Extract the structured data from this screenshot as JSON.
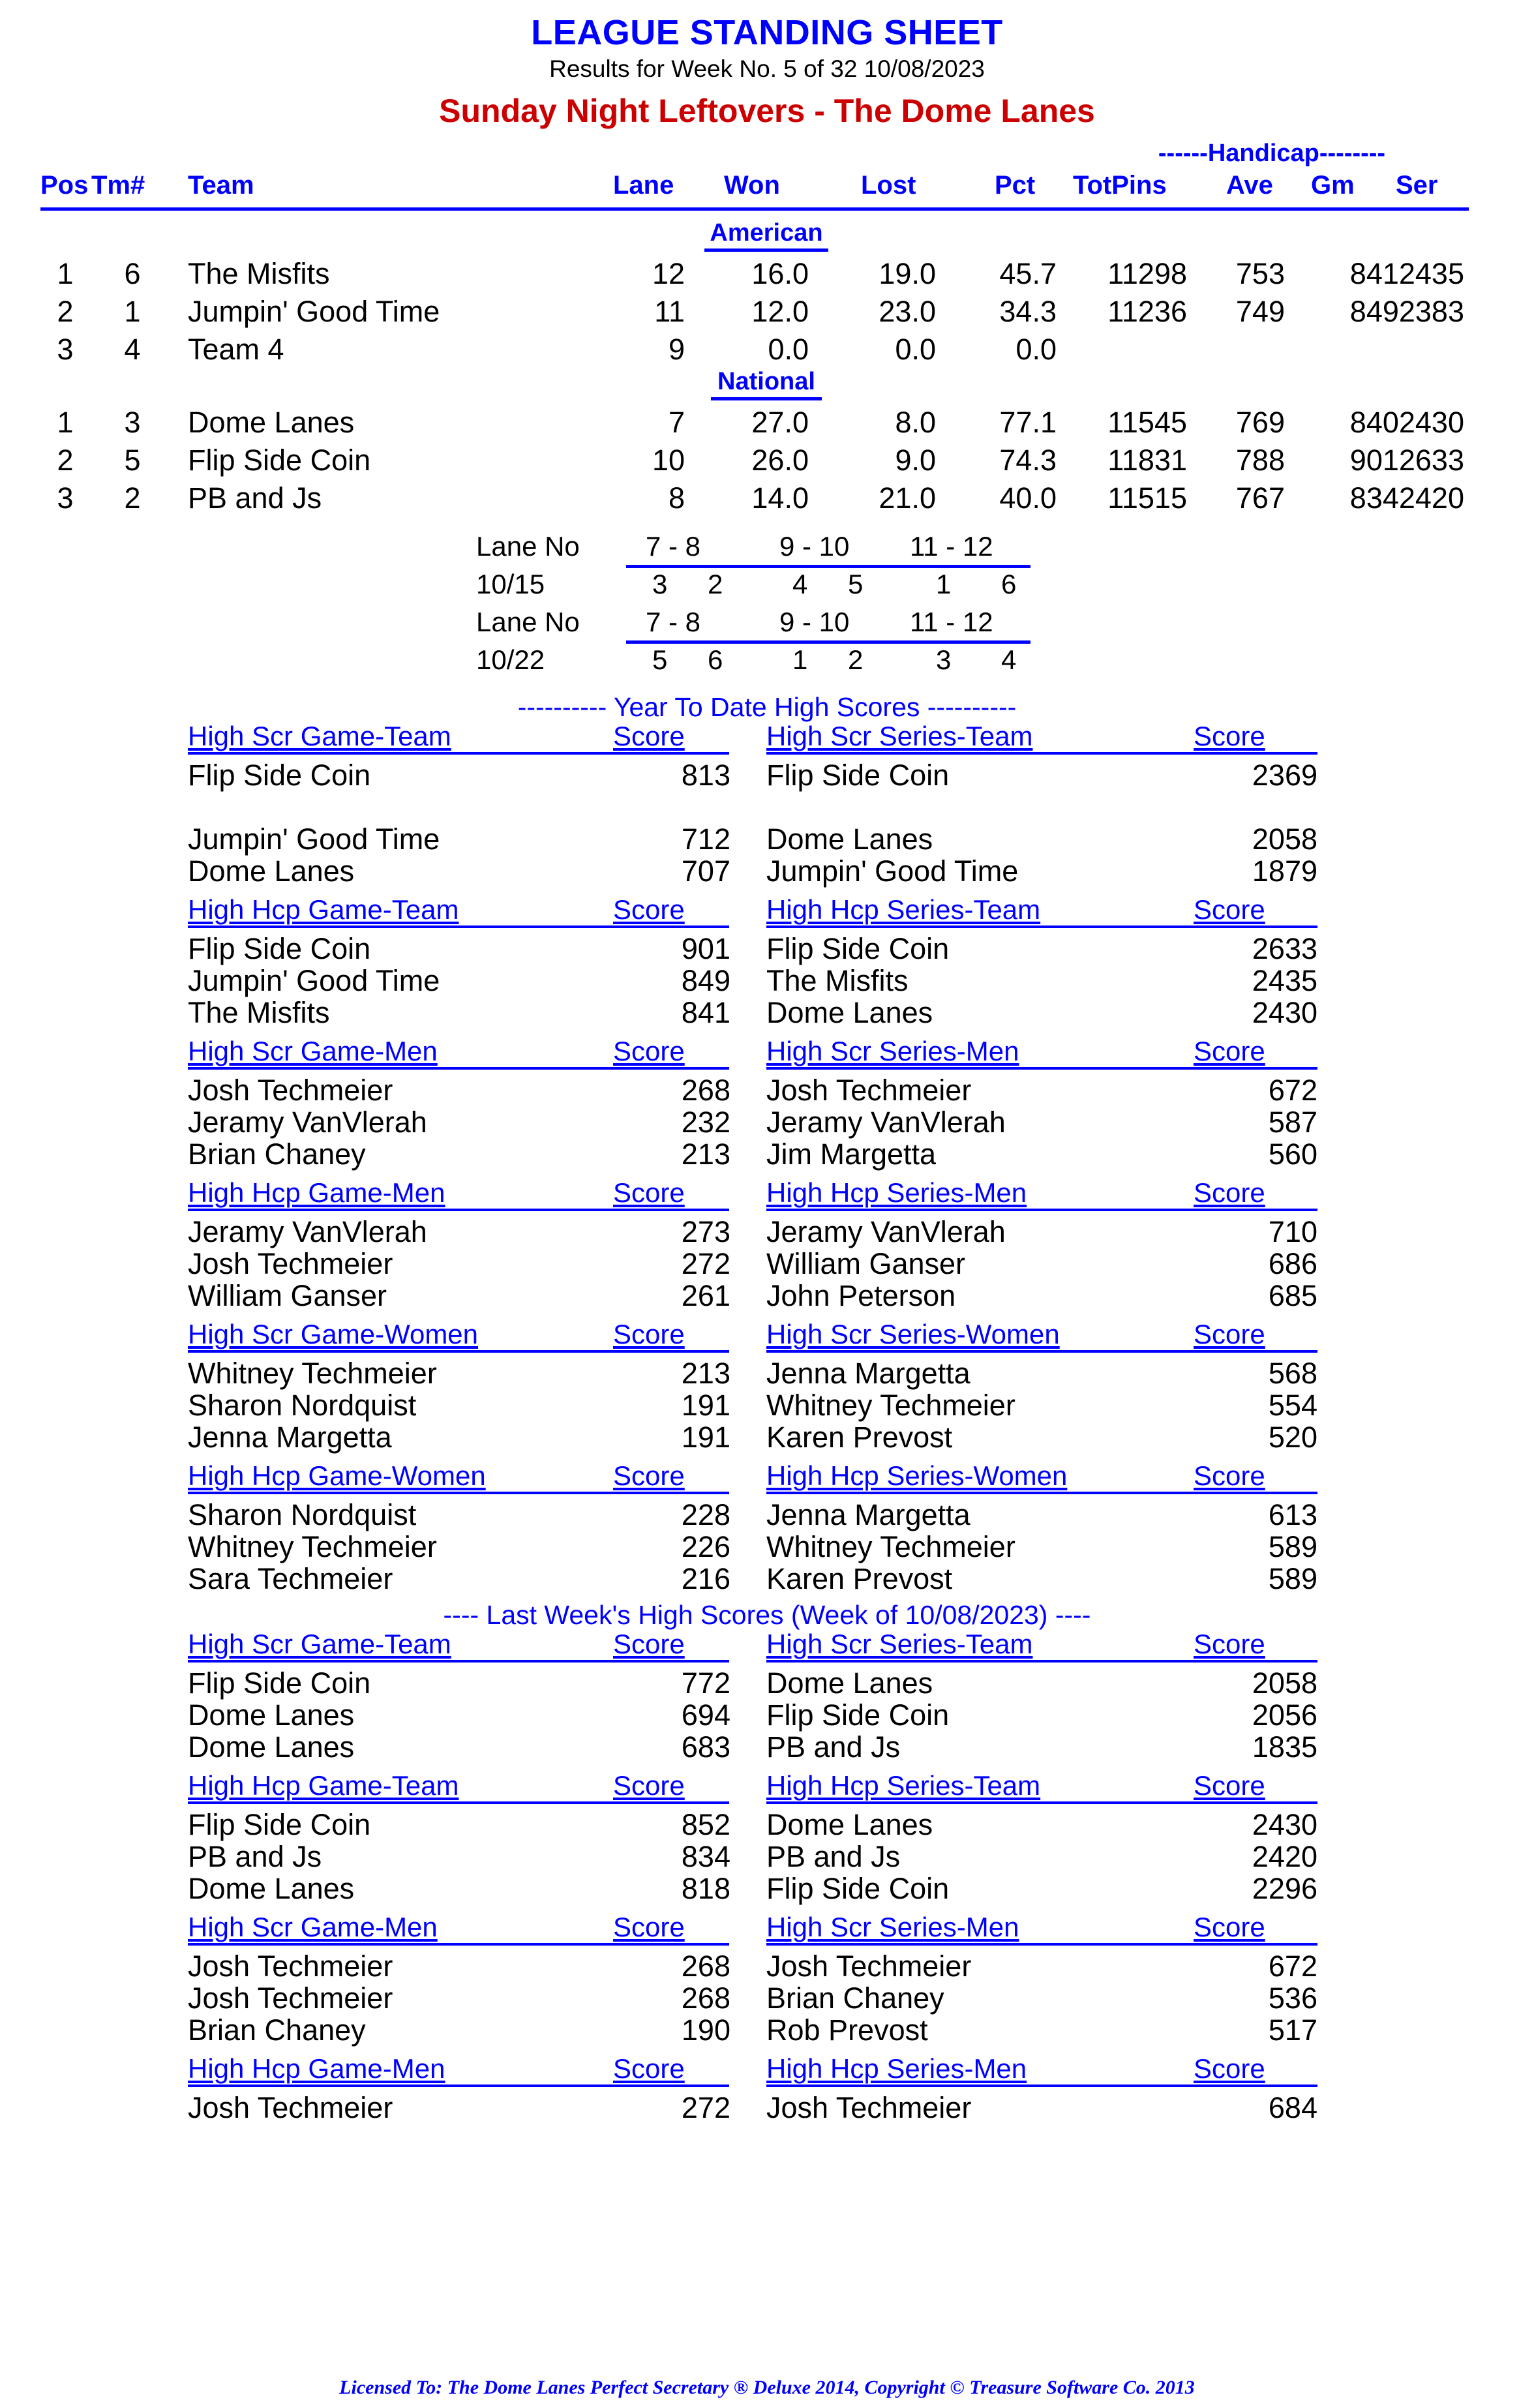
{
  "header": {
    "title": "LEAGUE STANDING SHEET",
    "subtitle": "Results for Week No. 5 of 32    10/08/2023",
    "league_title": "Sunday Night Leftovers - The Dome Lanes",
    "title_color": "#0000ff",
    "league_color": "#cc0000"
  },
  "standings": {
    "handicap_span_label": "------Handicap--------",
    "columns": {
      "pos": "Pos",
      "tm": "Tm#",
      "team": "Team",
      "lane": "Lane",
      "won": "Won",
      "lost": "Lost",
      "pct": "Pct",
      "totpins": "TotPins",
      "ave": "Ave",
      "gm": "Gm",
      "ser": "Ser"
    },
    "divisions": [
      {
        "name": "American",
        "rows": [
          {
            "pos": "1",
            "tm": "6",
            "team": "The Misfits",
            "lane": "12",
            "won": "16.0",
            "lost": "19.0",
            "pct": "45.7",
            "totpins": "11298",
            "ave": "753",
            "gm": "841",
            "ser": "2435"
          },
          {
            "pos": "2",
            "tm": "1",
            "team": "Jumpin' Good Time",
            "lane": "11",
            "won": "12.0",
            "lost": "23.0",
            "pct": "34.3",
            "totpins": "11236",
            "ave": "749",
            "gm": "849",
            "ser": "2383"
          },
          {
            "pos": "3",
            "tm": "4",
            "team": "Team 4",
            "lane": "9",
            "won": "0.0",
            "lost": "0.0",
            "pct": "0.0",
            "totpins": "",
            "ave": "",
            "gm": "",
            "ser": ""
          }
        ]
      },
      {
        "name": "National",
        "rows": [
          {
            "pos": "1",
            "tm": "3",
            "team": "Dome Lanes",
            "lane": "7",
            "won": "27.0",
            "lost": "8.0",
            "pct": "77.1",
            "totpins": "11545",
            "ave": "769",
            "gm": "840",
            "ser": "2430"
          },
          {
            "pos": "2",
            "tm": "5",
            "team": "Flip Side Coin",
            "lane": "10",
            "won": "26.0",
            "lost": "9.0",
            "pct": "74.3",
            "totpins": "11831",
            "ave": "788",
            "gm": "901",
            "ser": "2633"
          },
          {
            "pos": "3",
            "tm": "2",
            "team": "PB and Js",
            "lane": "8",
            "won": "14.0",
            "lost": "21.0",
            "pct": "40.0",
            "totpins": "11515",
            "ave": "767",
            "gm": "834",
            "ser": "2420"
          }
        ]
      }
    ]
  },
  "lane_schedule": [
    {
      "label": "Lane No",
      "pairs": [
        "7 -  8",
        "9 - 10",
        "11 - 12"
      ],
      "date": "10/15",
      "teams": [
        "3",
        "2",
        "4",
        "5",
        "1",
        "6"
      ]
    },
    {
      "label": "Lane No",
      "pairs": [
        "7 -  8",
        "9 - 10",
        "11 - 12"
      ],
      "date": "10/22",
      "teams": [
        "5",
        "6",
        "1",
        "2",
        "3",
        "4"
      ]
    }
  ],
  "ytd": {
    "separator": "---------- Year To Date High Scores ----------",
    "blocks": [
      {
        "left_header": "High Scr Game-Team",
        "left_score_header": "Score",
        "right_header": "High Scr Series-Team",
        "right_score_header": "Score",
        "left_rows": [
          {
            "name": "Flip Side Coin",
            "score": "813"
          },
          {
            "name": "",
            "score": ""
          },
          {
            "name": "Jumpin' Good Time",
            "score": "712"
          },
          {
            "name": "Dome Lanes",
            "score": "707"
          }
        ],
        "right_rows": [
          {
            "name": "Flip Side Coin",
            "score": "2369"
          },
          {
            "name": "",
            "score": ""
          },
          {
            "name": "Dome Lanes",
            "score": "2058"
          },
          {
            "name": "Jumpin' Good Time",
            "score": "1879"
          }
        ]
      },
      {
        "left_header": "High Hcp Game-Team",
        "left_score_header": "Score",
        "right_header": "High Hcp Series-Team",
        "right_score_header": "Score",
        "left_rows": [
          {
            "name": "Flip Side Coin",
            "score": "901"
          },
          {
            "name": "Jumpin' Good Time",
            "score": "849"
          },
          {
            "name": "The Misfits",
            "score": "841"
          }
        ],
        "right_rows": [
          {
            "name": "Flip Side Coin",
            "score": "2633"
          },
          {
            "name": "The Misfits",
            "score": "2435"
          },
          {
            "name": "Dome Lanes",
            "score": "2430"
          }
        ]
      },
      {
        "left_header": "High Scr Game-Men",
        "left_score_header": "Score",
        "right_header": "High Scr Series-Men",
        "right_score_header": "Score",
        "left_rows": [
          {
            "name": "Josh Techmeier",
            "score": "268"
          },
          {
            "name": "Jeramy VanVlerah",
            "score": "232"
          },
          {
            "name": "Brian Chaney",
            "score": "213"
          }
        ],
        "right_rows": [
          {
            "name": "Josh Techmeier",
            "score": "672"
          },
          {
            "name": "Jeramy VanVlerah",
            "score": "587"
          },
          {
            "name": "Jim Margetta",
            "score": "560"
          }
        ]
      },
      {
        "left_header": "High Hcp Game-Men",
        "left_score_header": "Score",
        "right_header": "High Hcp Series-Men",
        "right_score_header": "Score",
        "left_rows": [
          {
            "name": "Jeramy VanVlerah",
            "score": "273"
          },
          {
            "name": "Josh Techmeier",
            "score": "272"
          },
          {
            "name": "William Ganser",
            "score": "261"
          }
        ],
        "right_rows": [
          {
            "name": "Jeramy VanVlerah",
            "score": "710"
          },
          {
            "name": "William Ganser",
            "score": "686"
          },
          {
            "name": "John Peterson",
            "score": "685"
          }
        ]
      },
      {
        "left_header": "High Scr Game-Women",
        "left_score_header": "Score",
        "right_header": "High Scr Series-Women",
        "right_score_header": "Score",
        "left_rows": [
          {
            "name": "Whitney Techmeier",
            "score": "213"
          },
          {
            "name": "Sharon Nordquist",
            "score": "191"
          },
          {
            "name": "Jenna Margetta",
            "score": "191"
          }
        ],
        "right_rows": [
          {
            "name": "Jenna Margetta",
            "score": "568"
          },
          {
            "name": "Whitney Techmeier",
            "score": "554"
          },
          {
            "name": "Karen Prevost",
            "score": "520"
          }
        ]
      },
      {
        "left_header": "High Hcp Game-Women",
        "left_score_header": "Score",
        "right_header": "High Hcp Series-Women",
        "right_score_header": "Score",
        "left_rows": [
          {
            "name": "Sharon Nordquist",
            "score": "228"
          },
          {
            "name": "Whitney Techmeier",
            "score": "226"
          },
          {
            "name": "Sara Techmeier",
            "score": "216"
          }
        ],
        "right_rows": [
          {
            "name": "Jenna Margetta",
            "score": "613"
          },
          {
            "name": "Whitney Techmeier",
            "score": "589"
          },
          {
            "name": "Karen Prevost",
            "score": "589"
          }
        ]
      }
    ]
  },
  "last_week": {
    "separator": "----  Last Week's High Scores   (Week of 10/08/2023)  ----",
    "blocks": [
      {
        "left_header": "High Scr Game-Team",
        "left_score_header": "Score",
        "right_header": "High Scr Series-Team",
        "right_score_header": "Score",
        "left_rows": [
          {
            "name": "Flip Side Coin",
            "score": "772"
          },
          {
            "name": "Dome Lanes",
            "score": "694"
          },
          {
            "name": "Dome Lanes",
            "score": "683"
          }
        ],
        "right_rows": [
          {
            "name": "Dome Lanes",
            "score": "2058"
          },
          {
            "name": "Flip Side Coin",
            "score": "2056"
          },
          {
            "name": "PB and Js",
            "score": "1835"
          }
        ]
      },
      {
        "left_header": "High Hcp Game-Team",
        "left_score_header": "Score",
        "right_header": "High Hcp Series-Team",
        "right_score_header": "Score",
        "left_rows": [
          {
            "name": "Flip Side Coin",
            "score": "852"
          },
          {
            "name": "PB and Js",
            "score": "834"
          },
          {
            "name": "Dome Lanes",
            "score": "818"
          }
        ],
        "right_rows": [
          {
            "name": "Dome Lanes",
            "score": "2430"
          },
          {
            "name": "PB and Js",
            "score": "2420"
          },
          {
            "name": "Flip Side Coin",
            "score": "2296"
          }
        ]
      },
      {
        "left_header": "High Scr Game-Men",
        "left_score_header": "Score",
        "right_header": "High Scr Series-Men",
        "right_score_header": "Score",
        "left_rows": [
          {
            "name": "Josh Techmeier",
            "score": "268"
          },
          {
            "name": "Josh Techmeier",
            "score": "268"
          },
          {
            "name": "Brian Chaney",
            "score": "190"
          }
        ],
        "right_rows": [
          {
            "name": "Josh Techmeier",
            "score": "672"
          },
          {
            "name": "Brian Chaney",
            "score": "536"
          },
          {
            "name": "Rob Prevost",
            "score": "517"
          }
        ]
      },
      {
        "left_header": "High Hcp Game-Men",
        "left_score_header": "Score",
        "right_header": "High Hcp Series-Men",
        "right_score_header": "Score",
        "left_rows": [
          {
            "name": "Josh Techmeier",
            "score": "272"
          }
        ],
        "right_rows": [
          {
            "name": "Josh Techmeier",
            "score": "684"
          }
        ]
      }
    ]
  },
  "footer": {
    "text": "Licensed To: The Dome Lanes    Perfect Secretary ® Deluxe  2014, Copyright © Treasure Software Co. 2013"
  }
}
